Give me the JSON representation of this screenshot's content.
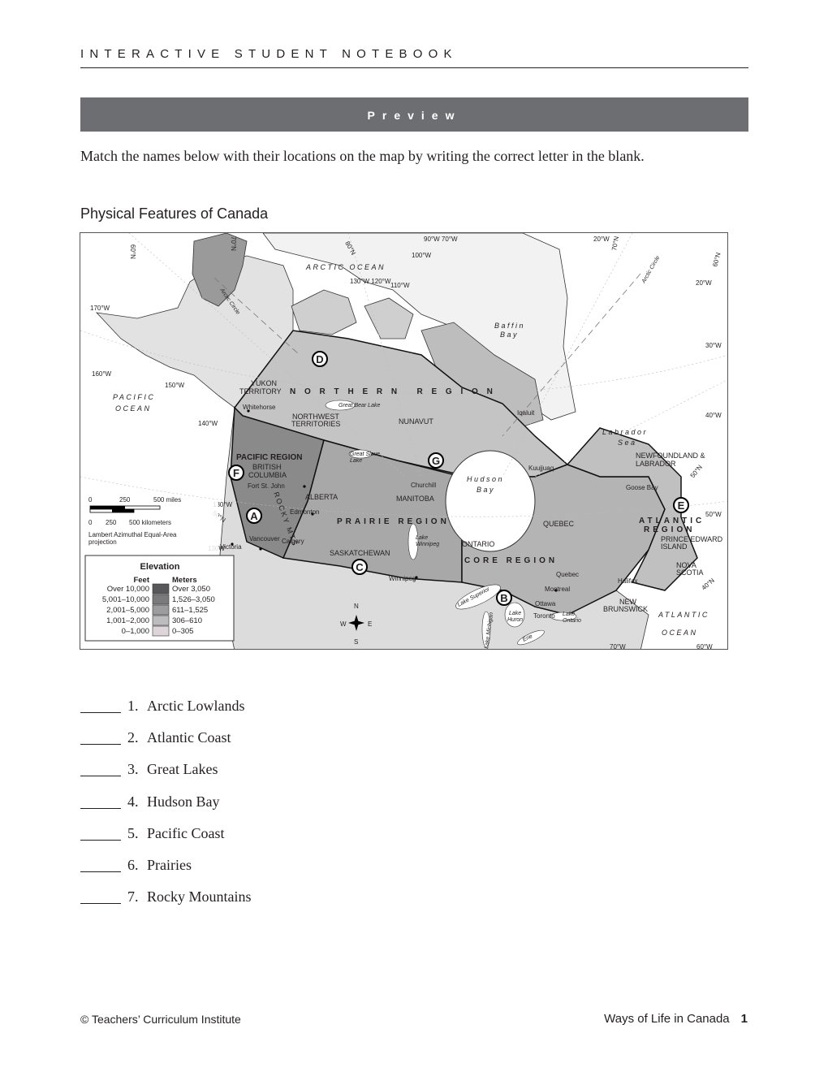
{
  "header": {
    "running_head": "INTERACTIVE STUDENT NOTEBOOK",
    "banner": "Preview"
  },
  "instructions": "Match the names below with their locations on the map by writing the correct letter in the blank.",
  "map": {
    "title": "Physical Features of Canada",
    "letters": [
      "A",
      "B",
      "C",
      "D",
      "E",
      "F",
      "G"
    ],
    "oceans": {
      "arctic": "ARCTIC OCEAN",
      "pacific1": "PACIFIC",
      "pacific2": "OCEAN",
      "atlantic1": "ATLANTIC",
      "atlantic2": "OCEAN",
      "baffin1": "Baffin",
      "baffin2": "Bay",
      "labrador1": "Labrador",
      "labrador2": "Sea",
      "hudson1": "Hudson",
      "hudson2": "Bay"
    },
    "regions": {
      "northern": "N O R T H E R N   R E G I O N",
      "pacific": "PACIFIC REGION",
      "prairie": "PRAIRIE REGION",
      "core": "CORE REGION",
      "atlantic1": "ATLANTIC",
      "atlantic2": "REGION"
    },
    "provinces": {
      "yukon1": "YUKON",
      "yukon2": "TERRITORY",
      "nwt1": "NORTHWEST",
      "nwt2": "TERRITORIES",
      "nunavut": "NUNAVUT",
      "bc1": "BRITISH",
      "bc2": "COLUMBIA",
      "alberta": "ALBERTA",
      "sask": "SASKATCHEWAN",
      "manitoba": "MANITOBA",
      "ontario": "ONTARIO",
      "quebec": "QUEBEC",
      "nl1": "NEWFOUNDLAND &",
      "nl2": "LABRADOR",
      "pei1": "PRINCE EDWARD",
      "pei2": "ISLAND",
      "ns1": "NOVA",
      "ns2": "SCOTIA",
      "nb1": "NEW",
      "nb2": "BRUNSWICK"
    },
    "cities": {
      "whitehorse": "Whitehorse",
      "fortstjohn": "Fort St. John",
      "edmonton": "Edmonton",
      "vancouver": "Vancouver",
      "calgary": "Calgary",
      "victoria": "Victoria",
      "winnipeg": "Winnipeg",
      "churchill": "Churchill",
      "iqaluit": "Iqaluit",
      "kuujjuaq": "Kuujjuaq",
      "goosebay": "Goose Bay",
      "quebec": "Quebec",
      "montreal": "Montreal",
      "ottawa": "Ottawa",
      "toronto": "Toronto",
      "halifax": "Halifax"
    },
    "lakes": {
      "greatbear": "Great Bear Lake",
      "greatslave1": "Great Slave",
      "greatslave2": "Lake",
      "winnipeg1": "Lake",
      "winnipeg2": "Winnipeg",
      "superior": "Lake Superior",
      "huron1": "Lake",
      "huron2": "Huron",
      "ontario1": "Lake",
      "ontario2": "Ontario",
      "michigan": "Lake Michigan",
      "erie": "Erie"
    },
    "features": {
      "rocky": "ROCKY MTS",
      "arctic_circle": "Arctic Circle"
    },
    "graticule": {
      "n60a": "60°N",
      "n70a": "70°N",
      "n80": "80°N",
      "w90_70": "90°W  70°W",
      "w100": "100°W",
      "w130_120": "130°W 120°W",
      "w110": "110°W",
      "w20a": "20°W",
      "n70b": "70°N",
      "n60b": "60°N",
      "w20b": "20°W",
      "w170": "170°W",
      "w30": "30°W",
      "w160": "160°W",
      "w150": "150°W",
      "w40": "40°W",
      "w140": "140°W",
      "n50a": "50°N",
      "w130a": "130°W",
      "n50b": "50°N",
      "w50": "50°W",
      "w130b": "130W",
      "n40": "40°N",
      "w70": "70°W",
      "w60": "60°W"
    },
    "scale": {
      "miles": [
        "0",
        "250",
        "500 miles"
      ],
      "km": [
        "0",
        "250",
        "500 kilometers"
      ]
    },
    "projection": [
      "Lambert Azimuthal Equal-Area",
      "projection"
    ],
    "compass": {
      "n": "N",
      "s": "S",
      "e": "E",
      "w": "W"
    },
    "legend": {
      "title": "Elevation",
      "feet_header": "Feet",
      "meters_header": "Meters",
      "rows": [
        {
          "feet": "Over 10,000",
          "meters": "Over 3,050",
          "color": "#58585a"
        },
        {
          "feet": "5,001–10,000",
          "meters": "1,526–3,050",
          "color": "#7a7a7c"
        },
        {
          "feet": "2,001–5,000",
          "meters": "611–1,525",
          "color": "#9c9c9e"
        },
        {
          "feet": "1,001–2,000",
          "meters": "306–610",
          "color": "#bcbcbe"
        },
        {
          "feet": "0–1,000",
          "meters": "0–305",
          "color": "#ddd5d9"
        }
      ]
    }
  },
  "questions": [
    {
      "num": "1.",
      "label": "Arctic Lowlands"
    },
    {
      "num": "2.",
      "label": "Atlantic Coast"
    },
    {
      "num": "3.",
      "label": "Great Lakes"
    },
    {
      "num": "4.",
      "label": "Hudson Bay"
    },
    {
      "num": "5.",
      "label": "Pacific Coast"
    },
    {
      "num": "6.",
      "label": "Prairies"
    },
    {
      "num": "7.",
      "label": "Rocky Mountains"
    }
  ],
  "footer": {
    "copyright": "© Teachers’ Curriculum Institute",
    "book": "Ways of Life in Canada",
    "page": "1"
  }
}
